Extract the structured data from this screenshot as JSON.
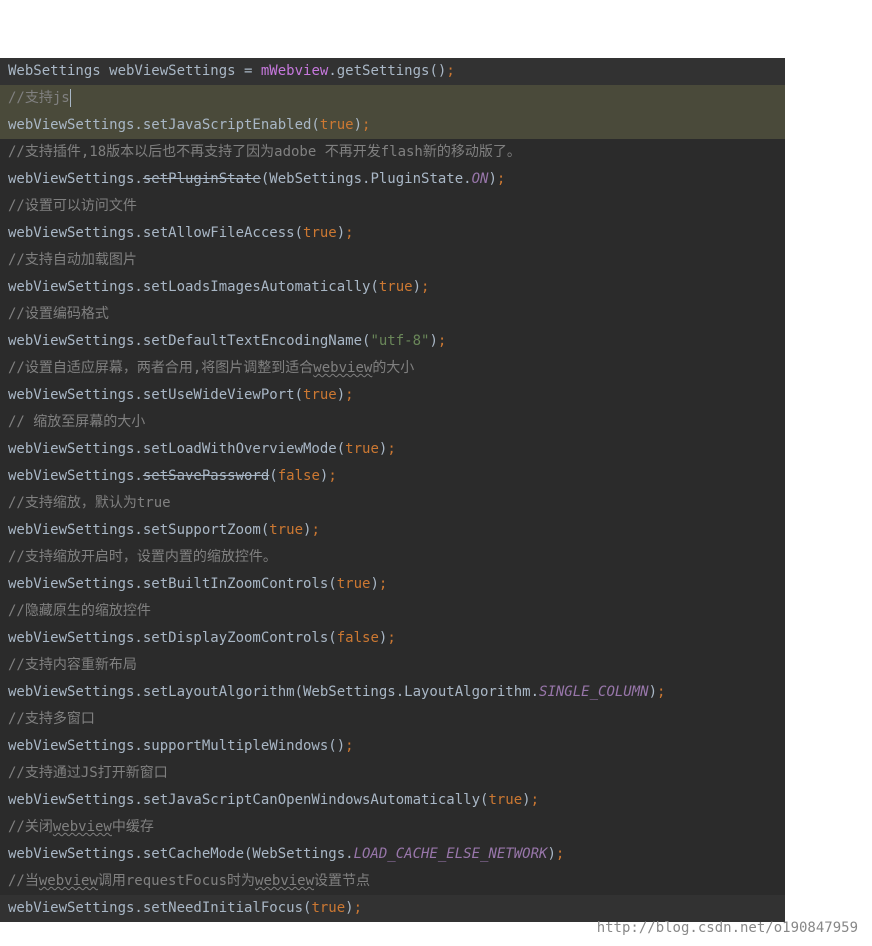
{
  "lines": [
    {
      "class": "highlight-line",
      "parts": [
        {
          "t": "WebSettings webViewSettings = ",
          "c": "keyword-var"
        },
        {
          "t": "mWebview",
          "c": "member"
        },
        {
          "t": ".getSettings()",
          "c": "method"
        },
        {
          "t": ";",
          "c": "semi"
        }
      ]
    },
    {
      "class": "line-yellow cursor-line",
      "parts": [
        {
          "t": "//支持js",
          "c": "comment"
        },
        {
          "t": "",
          "c": "cursor-mark"
        }
      ]
    },
    {
      "class": "line-yellow",
      "parts": [
        {
          "t": "webViewSettings.setJavaScriptEnabled(",
          "c": "method"
        },
        {
          "t": "true",
          "c": "bool"
        },
        {
          "t": ")",
          "c": "paren"
        },
        {
          "t": ";",
          "c": "semi"
        }
      ]
    },
    {
      "class": "",
      "parts": [
        {
          "t": "//支持插件,18版本以后也不再支持了因为adobe 不再开发flash新的移动版了。",
          "c": "comment"
        }
      ]
    },
    {
      "class": "",
      "parts": [
        {
          "t": "webViewSettings.",
          "c": "method"
        },
        {
          "t": "setPluginState",
          "c": "strikethrough"
        },
        {
          "t": "(WebSettings.PluginState.",
          "c": "method"
        },
        {
          "t": "ON",
          "c": "constant"
        },
        {
          "t": ")",
          "c": "paren"
        },
        {
          "t": ";",
          "c": "semi"
        }
      ]
    },
    {
      "class": "",
      "parts": [
        {
          "t": "//设置可以访问文件",
          "c": "comment"
        }
      ]
    },
    {
      "class": "",
      "parts": [
        {
          "t": "webViewSettings.setAllowFileAccess(",
          "c": "method"
        },
        {
          "t": "true",
          "c": "bool"
        },
        {
          "t": ")",
          "c": "paren"
        },
        {
          "t": ";",
          "c": "semi"
        }
      ]
    },
    {
      "class": "",
      "parts": [
        {
          "t": "//支持自动加载图片",
          "c": "comment"
        }
      ]
    },
    {
      "class": "",
      "parts": [
        {
          "t": "webViewSettings.setLoadsImagesAutomatically(",
          "c": "method"
        },
        {
          "t": "true",
          "c": "bool"
        },
        {
          "t": ")",
          "c": "paren"
        },
        {
          "t": ";",
          "c": "semi"
        }
      ]
    },
    {
      "class": "",
      "parts": [
        {
          "t": "//设置编码格式",
          "c": "comment"
        }
      ]
    },
    {
      "class": "",
      "parts": [
        {
          "t": "webViewSettings.setDefaultTextEncodingName(",
          "c": "method"
        },
        {
          "t": "\"utf-8\"",
          "c": "string"
        },
        {
          "t": ")",
          "c": "paren"
        },
        {
          "t": ";",
          "c": "semi"
        }
      ]
    },
    {
      "class": "",
      "parts": [
        {
          "t": "//设置自适应屏幕，两者合用,将图片调整到适合",
          "c": "comment"
        },
        {
          "t": "webview",
          "c": "comment wavy"
        },
        {
          "t": "的大小",
          "c": "comment"
        }
      ]
    },
    {
      "class": "",
      "parts": [
        {
          "t": "webViewSettings.setUseWideViewPort(",
          "c": "method"
        },
        {
          "t": "true",
          "c": "bool"
        },
        {
          "t": ")",
          "c": "paren"
        },
        {
          "t": ";",
          "c": "semi"
        }
      ]
    },
    {
      "class": "",
      "parts": [
        {
          "t": "// 缩放至屏幕的大小",
          "c": "comment"
        }
      ]
    },
    {
      "class": "",
      "parts": [
        {
          "t": "webViewSettings.setLoadWithOverviewMode(",
          "c": "method"
        },
        {
          "t": "true",
          "c": "bool"
        },
        {
          "t": ")",
          "c": "paren"
        },
        {
          "t": ";",
          "c": "semi"
        }
      ]
    },
    {
      "class": "",
      "parts": [
        {
          "t": "webViewSettings.",
          "c": "method"
        },
        {
          "t": "setSavePassword",
          "c": "strikethrough"
        },
        {
          "t": "(",
          "c": "paren"
        },
        {
          "t": "false",
          "c": "bool"
        },
        {
          "t": ")",
          "c": "paren"
        },
        {
          "t": ";",
          "c": "semi"
        }
      ]
    },
    {
      "class": "",
      "parts": [
        {
          "t": "//支持缩放，默认为true",
          "c": "comment"
        }
      ]
    },
    {
      "class": "",
      "parts": [
        {
          "t": "webViewSettings.setSupportZoom(",
          "c": "method"
        },
        {
          "t": "true",
          "c": "bool"
        },
        {
          "t": ")",
          "c": "paren"
        },
        {
          "t": ";",
          "c": "semi"
        }
      ]
    },
    {
      "class": "",
      "parts": [
        {
          "t": "//支持缩放开启时，设置内置的缩放控件。",
          "c": "comment"
        }
      ]
    },
    {
      "class": "",
      "parts": [
        {
          "t": "webViewSettings.setBuiltInZoomControls(",
          "c": "method"
        },
        {
          "t": "true",
          "c": "bool"
        },
        {
          "t": ")",
          "c": "paren"
        },
        {
          "t": ";",
          "c": "semi"
        }
      ]
    },
    {
      "class": "",
      "parts": [
        {
          "t": "//隐藏原生的缩放控件",
          "c": "comment"
        }
      ]
    },
    {
      "class": "",
      "parts": [
        {
          "t": "webViewSettings.setDisplayZoomControls(",
          "c": "method"
        },
        {
          "t": "false",
          "c": "bool"
        },
        {
          "t": ")",
          "c": "paren"
        },
        {
          "t": ";",
          "c": "semi"
        }
      ]
    },
    {
      "class": "",
      "parts": [
        {
          "t": "//支持内容重新布局",
          "c": "comment"
        }
      ]
    },
    {
      "class": "",
      "parts": [
        {
          "t": "webViewSettings.setLayoutAlgorithm(WebSettings.LayoutAlgorithm.",
          "c": "method"
        },
        {
          "t": "SINGLE_COLUMN",
          "c": "constant"
        },
        {
          "t": ")",
          "c": "paren"
        },
        {
          "t": ";",
          "c": "semi"
        }
      ]
    },
    {
      "class": "",
      "parts": [
        {
          "t": "//支持多窗口",
          "c": "comment"
        }
      ]
    },
    {
      "class": "",
      "parts": [
        {
          "t": "webViewSettings.supportMultipleWindows()",
          "c": "method"
        },
        {
          "t": ";",
          "c": "semi"
        }
      ]
    },
    {
      "class": "",
      "parts": [
        {
          "t": "//支持通过JS打开新窗口",
          "c": "comment"
        }
      ]
    },
    {
      "class": "",
      "parts": [
        {
          "t": "webViewSettings.setJavaScriptCanOpenWindowsAutomatically(",
          "c": "method"
        },
        {
          "t": "true",
          "c": "bool"
        },
        {
          "t": ")",
          "c": "paren"
        },
        {
          "t": ";",
          "c": "semi"
        }
      ]
    },
    {
      "class": "",
      "parts": [
        {
          "t": "//关闭",
          "c": "comment"
        },
        {
          "t": "webview",
          "c": "comment wavy"
        },
        {
          "t": "中缓存",
          "c": "comment"
        }
      ]
    },
    {
      "class": "",
      "parts": [
        {
          "t": "webViewSettings.setCacheMode(WebSettings.",
          "c": "method"
        },
        {
          "t": "LOAD_CACHE_ELSE_NETWORK",
          "c": "constant"
        },
        {
          "t": ")",
          "c": "paren"
        },
        {
          "t": ";",
          "c": "semi"
        }
      ]
    },
    {
      "class": "",
      "parts": [
        {
          "t": "//当",
          "c": "comment"
        },
        {
          "t": "webview",
          "c": "comment wavy"
        },
        {
          "t": "调用requestFocus时为",
          "c": "comment"
        },
        {
          "t": "webview",
          "c": "comment wavy"
        },
        {
          "t": "设置节点",
          "c": "comment"
        }
      ]
    },
    {
      "class": "highlight-line",
      "parts": [
        {
          "t": "webViewSettings.setNeedInitialFocus(",
          "c": "method"
        },
        {
          "t": "true",
          "c": "bool"
        },
        {
          "t": ")",
          "c": "paren"
        },
        {
          "t": ";",
          "c": "semi"
        }
      ]
    }
  ],
  "watermark": "http://blog.csdn.net/o190847959"
}
